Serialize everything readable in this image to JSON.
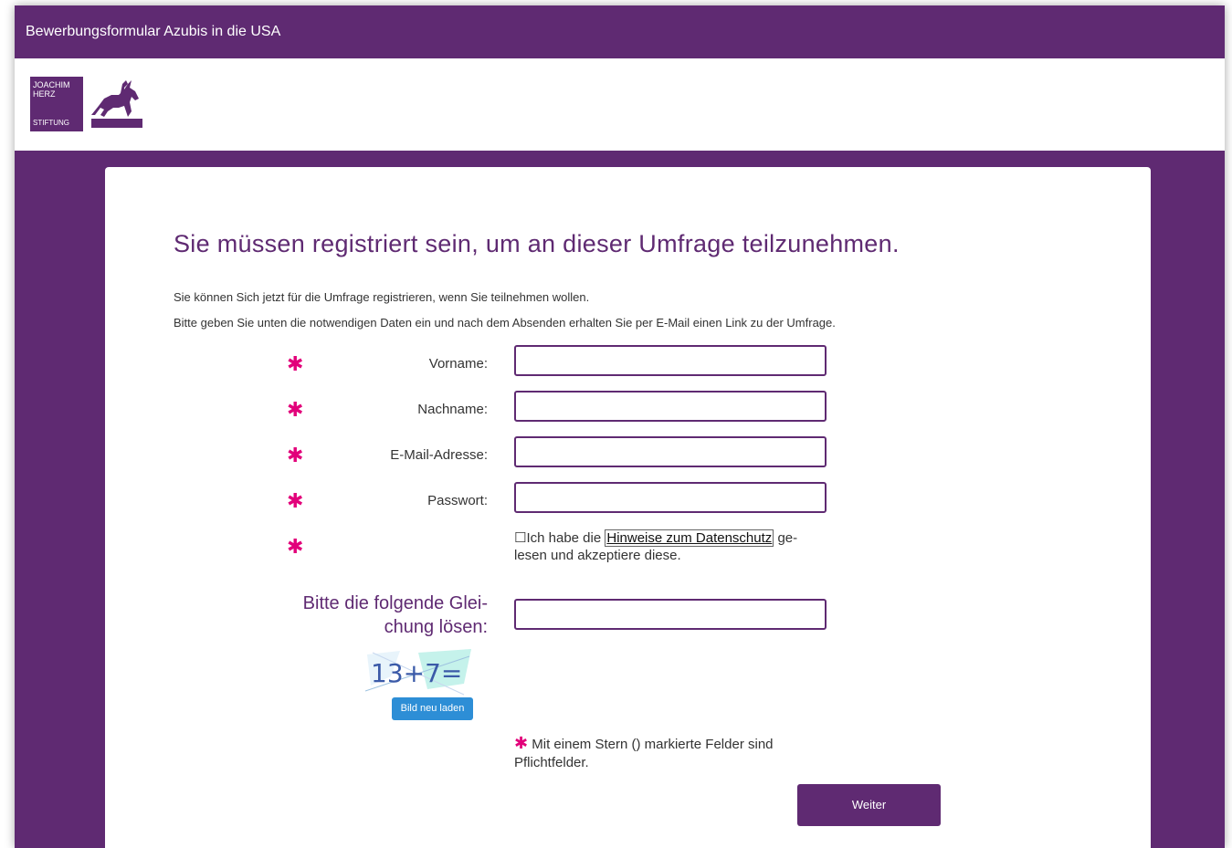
{
  "header": {
    "title": "Bewerbungsformular Azubis in die USA"
  },
  "logo": {
    "line1": "JOACHIM",
    "line2": "HERZ",
    "line3": "STIFTUNG"
  },
  "main": {
    "heading": "Sie müssen registriert sein, um an dieser Umfrage teilzunehmen.",
    "intro1": "Sie können Sich jetzt für die Umfrage registrieren, wenn Sie teilnehmen wollen.",
    "intro2": "Bitte geben Sie unten die notwendigen Daten ein und nach dem Absenden erhalten Sie per E-Mail einen Link zu der Umfrage."
  },
  "form": {
    "required_mark": "✱",
    "fields": [
      {
        "label": "Vorname:",
        "value": ""
      },
      {
        "label": "Nachname:",
        "value": ""
      },
      {
        "label": "E-Mail-Adresse:",
        "value": ""
      },
      {
        "label": "Passwort:",
        "value": ""
      }
    ],
    "consent": {
      "checkbox": "☐",
      "prefix": "Ich habe die ",
      "link": "Hinweise zum Datenschutz",
      "suffix": " ge-lesen und akzeptiere diese."
    },
    "captcha": {
      "label": "Bitte die folgende Glei-chung lösen:",
      "image_text": "13+7=",
      "answer": "",
      "reload_label": "Bild neu laden"
    },
    "required_note": "Mit einem Stern () markierte Felder sind Pflichtfelder.",
    "submit_label": "Weiter"
  },
  "colors": {
    "brand": "#5f2a72",
    "required": "#e2007a",
    "reload_button": "#2d8ed6"
  },
  "icons": {
    "logo_mark": "horse-rider-icon",
    "checkbox": "checkbox-unchecked-icon"
  }
}
